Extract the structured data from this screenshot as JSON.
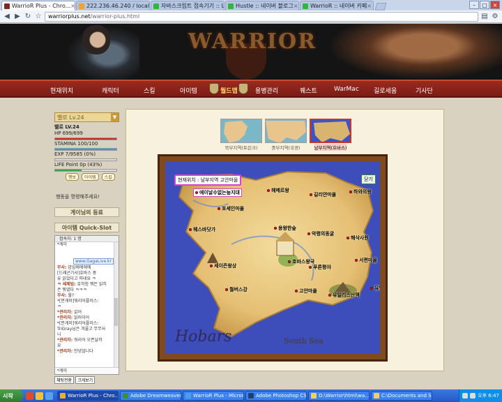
{
  "browser": {
    "tabs": [
      {
        "label": "WarrioR Plus - Chro...",
        "icon": "warrior-icon",
        "active": true
      },
      {
        "label": "222.236.46.240 / localhost / ...",
        "icon": "phpmyadmin-icon"
      },
      {
        "label": "자바스크립트 접속기기 :: L...",
        "icon": "naver-icon"
      },
      {
        "label": "Hustle :: 네이버 블로그",
        "icon": "naver-icon"
      },
      {
        "label": "WarrioR :: 네이버 카페",
        "icon": "naver-icon"
      }
    ],
    "url_host": "warriorplus.net",
    "url_path": "/warrior-plus.html"
  },
  "site": {
    "logo": "WARRIOR",
    "menu": [
      "현재위치",
      "캐릭터",
      "스킬",
      "아이템",
      "월드맵",
      "용병관리",
      "퀘스트",
      "WarMac",
      "길로세움",
      "기사단"
    ],
    "menu_selected": "월드맵"
  },
  "sidebar": {
    "char_select": "벨로 Lv.24",
    "char_name": "벨로 LV.24",
    "hp": "HP 699/699",
    "stamina": "STAMINA 100/100",
    "exp": "EXP 7/9585 (0%)",
    "life": "LIFE Point 0p (43%)",
    "buttons": [
      "행보",
      "아이템",
      "스킬"
    ],
    "notice": "행동을 명령해주세요!",
    "rank_title": "게이님의 등료",
    "quickslot_title": "아이템 Quick-Slot",
    "chat_header": "접속자: 1 명",
    "chat_top_line": "*게이",
    "gaga_link": "www.GagaLive.kr",
    "chat_lines": [
      {
        "who": "무사:",
        "msg": "암임에에에에"
      },
      {
        "who": "",
        "msg": "[드래곤기사]호바스 중"
      },
      {
        "who": "",
        "msg": "유 읽었다고 띄네요 ㅋ"
      },
      {
        "who": "ㅋ 세제빙:",
        "msg": "호히힝 뭐든 읽히"
      },
      {
        "who": "",
        "msg": "은 뭐였다 ㅋㅋㅋ"
      },
      {
        "who": "무사:",
        "msg": "월?"
      },
      {
        "who": "",
        "msg": "*[분게미]워리어플러스:"
      },
      {
        "who": "",
        "msg": "ㅋ"
      },
      {
        "who": "*관리자:",
        "msg": "읽어"
      },
      {
        "who": "*관리자:",
        "msg": "읽러이어"
      },
      {
        "who": "",
        "msg": "*[분게미]워리어플러스:"
      },
      {
        "who": "",
        "msg": "TriGray님은 겨울고 무무사"
      },
      {
        "who": "",
        "msg": "니"
      },
      {
        "who": "*관리자:",
        "msg": "워리어 오픈날까"
      },
      {
        "who": "",
        "msg": "요"
      },
      {
        "who": "*관리자:",
        "msg": "안녕않니다"
      }
    ],
    "chat_input": "*게이",
    "chat_buttons": [
      "채팅전환",
      "크게보기"
    ]
  },
  "regions": [
    {
      "label": "북부지역(토린크)",
      "selected": false
    },
    {
      "label": "중부지역(국경)",
      "selected": false
    },
    {
      "label": "남부지역(호바스)",
      "selected": true
    }
  ],
  "map": {
    "current_location": "현재위치 : 남부지역 고안마을",
    "close_button": "닫기",
    "title": "Hobars",
    "sea_label": "South Sea",
    "places": [
      {
        "name": "에이날수없는늪지대",
        "hl": true
      },
      {
        "name": "헤메르왕"
      },
      {
        "name": "길리얀마을"
      },
      {
        "name": "하와의왕"
      },
      {
        "name": "포세인마을"
      },
      {
        "name": "웨스바닷가"
      },
      {
        "name": "용왕한숲"
      },
      {
        "name": "악령의동굴"
      },
      {
        "name": "해삭사원"
      },
      {
        "name": "호바스왕국"
      },
      {
        "name": "서편마을"
      },
      {
        "name": "세이즌왕상"
      },
      {
        "name": "푸른평야"
      },
      {
        "name": "유일리스광산"
      },
      {
        "name": "월버스강"
      },
      {
        "name": "고안마을"
      },
      {
        "name": "유일리스산맥"
      }
    ]
  },
  "taskbar": {
    "start": "시작",
    "tasks": [
      "WarrioR Plus - Chro...",
      "Adobe Dreamweaver C...",
      "WarrioR Plus - Microsoft...",
      "Adobe Photoshop CS3",
      "D:\\Warrior\\html\\wa...",
      "C:\\Documents and Set..."
    ],
    "clock": "오후 6:47"
  }
}
